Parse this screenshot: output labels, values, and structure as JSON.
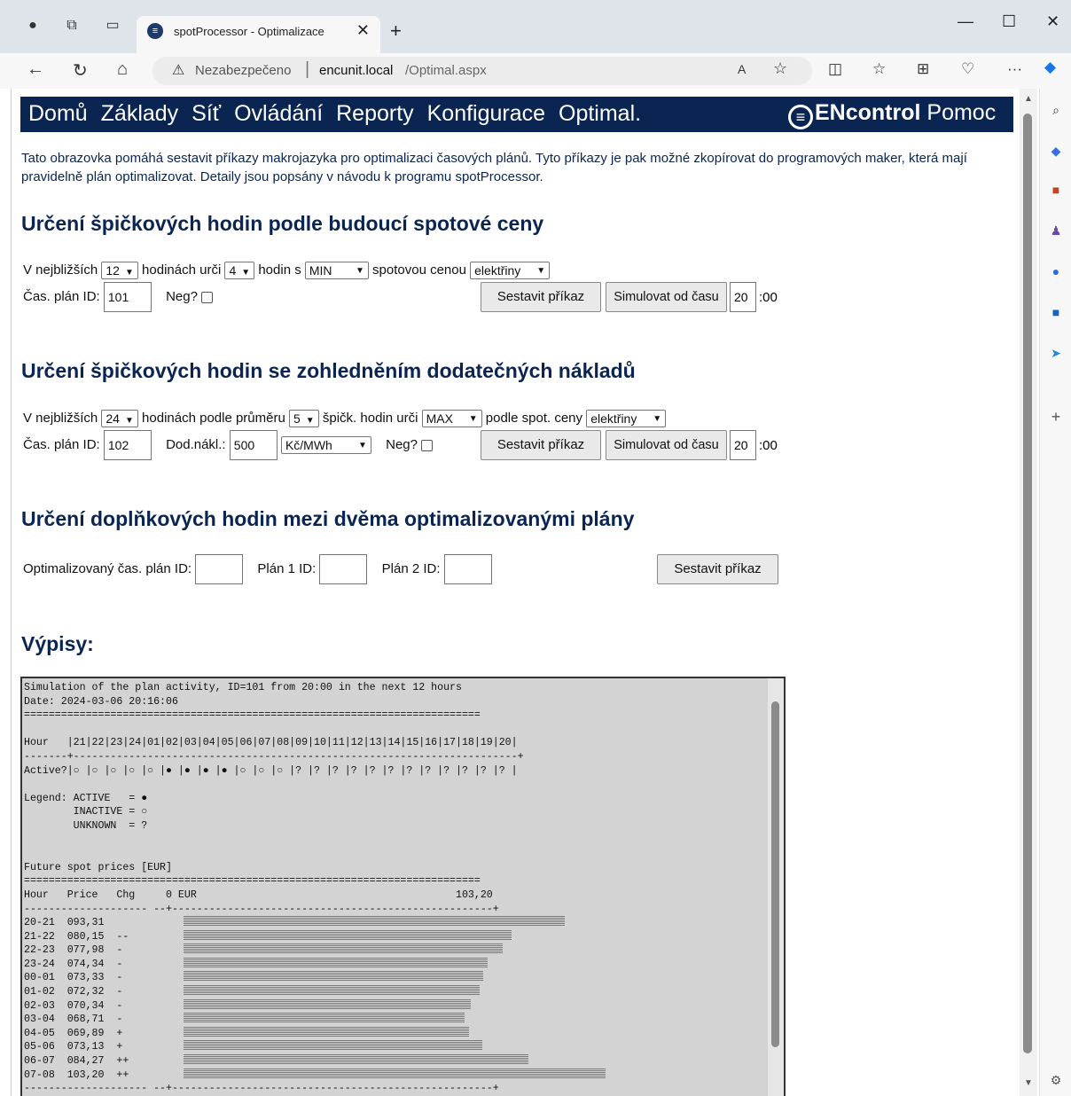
{
  "browser": {
    "tab_title": "spotProcessor - Optimalizace",
    "tab_close": "✕",
    "new_tab": "+",
    "not_secure": "Nezabezpečeno",
    "url_host": "encunit.local",
    "url_path": "/Optimal.aspx",
    "read_aloud": "A",
    "more": "···",
    "window_minimize": "—",
    "window_maximize": "☐",
    "window_close": "✕"
  },
  "menu": {
    "items": [
      "Domů",
      "Základy",
      "Síť",
      "Ovládání",
      "Reporty",
      "Konfigurace",
      "Optimal."
    ],
    "brand_bold": "ENcontrol",
    "brand_rest": " Pomoc"
  },
  "intro": "Tato obrazovka pomáhá sestavit příkazy makrojazyka pro optimalizaci časových plánů. Tyto příkazy je pak možné zkopírovat do programových maker, která mají pravidelně plán optimalizovat. Detaily jsou popsány v návodu k programu spotProcessor.",
  "section1": {
    "heading": "Určení špičkových hodin podle budoucí spotové ceny",
    "t_next": "V nejbližších",
    "hours_val": "12",
    "t_hours": "hodinách urči",
    "count_val": "4",
    "t_hod": "hodin s",
    "minmax_val": "MIN",
    "t_price": "spotovou cenou",
    "commodity_val": "elektřiny",
    "t_plan": "Čas. plán ID:",
    "plan_id": "101",
    "t_neg": "Neg?",
    "build_btn": "Sestavit příkaz",
    "sim_btn": "Simulovat od času",
    "sim_hour": "20",
    "sim_suffix": ":00"
  },
  "section2": {
    "heading": "Určení špičkových hodin se zohledněním dodatečných nákladů",
    "t_next": "V nejbližších",
    "hours_val": "24",
    "t_avg": "hodinách podle průměru",
    "avg_val": "5",
    "t_peak": "špičk. hodin urči",
    "minmax_val": "MAX",
    "t_spot": "podle spot. ceny",
    "commodity_val": "elektřiny",
    "t_plan": "Čas. plán ID:",
    "plan_id": "102",
    "t_cost": "Dod.nákl.:",
    "cost_val": "500",
    "unit_val": "Kč/MWh",
    "t_neg": "Neg?",
    "build_btn": "Sestavit příkaz",
    "sim_btn": "Simulovat od času",
    "sim_hour": "20",
    "sim_suffix": ":00"
  },
  "section3": {
    "heading": "Určení doplňkových hodin mezi dvěma optimalizovanými plány",
    "t_opt": "Optimalizovaný čas. plán ID:",
    "t_p1": "Plán 1 ID:",
    "t_p2": "Plán 2 ID:",
    "build_btn": "Sestavit příkaz"
  },
  "output": {
    "heading": "Výpisy:",
    "text": "Simulation of the plan activity, ID=101 from 20:00 in the next 12 hours\nDate: 2024-03-06 20:16:06\n==========================================================================\n\nHour   |21|22|23|24|01|02|03|04|05|06|07|08|09|10|11|12|13|14|15|16|17|18|19|20|\n-------+------------------------------------------------------------------------+\nActive?|○ |○ |○ |○ |○ |● |● |● |● |○ |○ |○ |? |? |? |? |? |? |? |? |? |? |? |? |\n\nLegend: ACTIVE   = ●\n        INACTIVE = ○\n        UNKNOWN  = ?\n\n\nFuture spot prices [EUR]\n==========================================================================\nHour   Price   Chg     0 EUR                                          103,20\n-------------------- --+----------------------------------------------------+\n20-21  093,31\n21-22  080,15  --\n22-23  077,98  -\n23-24  074,34  -\n00-01  073,33  -\n01-02  072,32  -\n02-03  070,34  -\n03-04  068,71  -\n04-05  069,89  +\n05-06  073,13  +\n06-07  084,27  ++\n07-08  103,20  ++\n-------------------- --+----------------------------------------------------+",
    "prices": [
      93.31,
      80.15,
      77.98,
      74.34,
      73.33,
      72.32,
      70.34,
      68.71,
      69.89,
      73.13,
      84.27,
      103.2
    ],
    "max_price": 103.2
  }
}
